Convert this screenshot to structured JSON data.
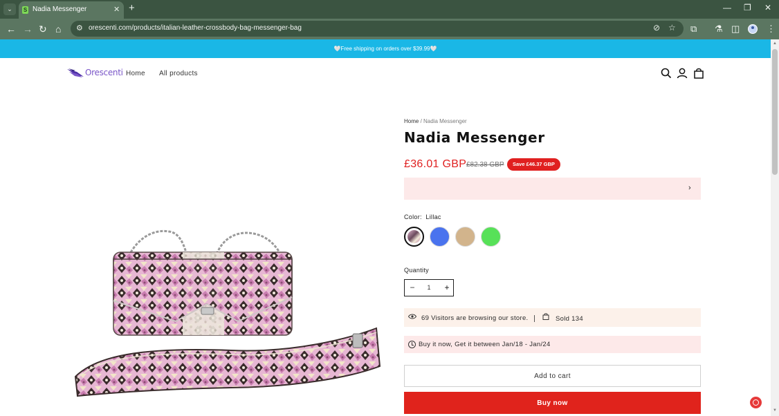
{
  "browser": {
    "tab_title": "Nadia Messenger",
    "url": "orescenti.com/products/italian-leather-crossbody-bag-messenger-bag",
    "icons": {
      "tab_list": "chevron-down-icon",
      "tab_favicon": "shopify-bag-icon",
      "tab_close": "close-icon",
      "new_tab": "plus-icon",
      "minimize": "minimize-icon",
      "restore": "restore-icon",
      "close_window": "close-icon",
      "back": "back-arrow-icon",
      "forward": "forward-arrow-icon",
      "reload": "reload-icon",
      "home": "home-icon",
      "site_info": "tune-icon",
      "eye_off": "eye-off-icon",
      "bookmark": "star-icon",
      "extensions": "puzzle-icon",
      "labs": "flask-icon",
      "side_panel": "side-panel-icon",
      "menu": "kebab-menu-icon"
    },
    "glyphs": {
      "tab_list": "⌄",
      "tab_close": "✕",
      "new_tab": "+",
      "minimize": "—",
      "restore": "❐",
      "close_window": "✕",
      "back": "←",
      "forward": "→",
      "reload": "↻",
      "home": "⌂",
      "site_info": "⚙",
      "eye_off": "⊘",
      "bookmark": "☆",
      "extensions": "⧉",
      "labs": "⚗",
      "side_panel": "◫",
      "menu": "⋮"
    }
  },
  "announcement": "🤍Free shipping on orders over $39.99🤍",
  "header": {
    "logo_text": "Orescenti",
    "nav": [
      "Home",
      "All products"
    ],
    "icons": {
      "search": "search-icon",
      "account": "account-icon",
      "cart": "cart-icon"
    }
  },
  "product": {
    "breadcrumb": {
      "home": "Home",
      "separator": " / ",
      "current": "Nadia Messenger"
    },
    "title": "Nadia Messenger",
    "price_current": "£36.01 GBP",
    "price_old": "£82.38 GBP",
    "save_badge": "Save £46.37 GBP",
    "color_label": "Color:",
    "color_value": "Lillac",
    "swatches": [
      {
        "name": "Lillac",
        "color": "#c48fb0",
        "selected": true
      },
      {
        "name": "Blue",
        "color": "#4a73ee",
        "selected": false
      },
      {
        "name": "Beige",
        "color": "#d2b48c",
        "selected": false
      },
      {
        "name": "Green",
        "color": "#57e158",
        "selected": false
      }
    ],
    "quantity_label": "Quantity",
    "quantity_value": "1",
    "quantity_minus": "−",
    "quantity_plus": "+",
    "visitors_text": "69 Visitors are browsing our store.",
    "divider": "|",
    "sold_text": "Sold 134",
    "delivery_text": "Buy it now, Get it between Jan/18 - Jan/24",
    "add_to_cart": "Add to cart",
    "buy_now": "Buy now",
    "promo_chevron": "›"
  },
  "colors": {
    "announcement_bg": "#1ab7e6",
    "accent_red": "#e0231c",
    "browser_frame": "#3b5441",
    "browser_toolbar": "#5b7661",
    "promo_bg": "#fde9e9",
    "visitors_bg": "#fcf1ea"
  }
}
